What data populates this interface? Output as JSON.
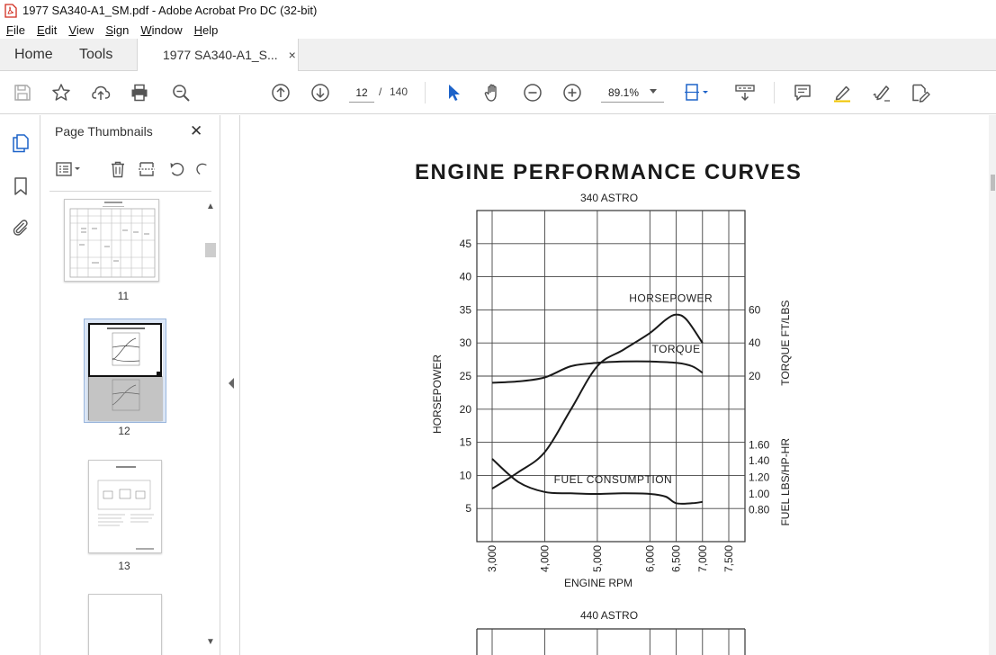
{
  "window": {
    "title": "1977 SA340-A1_SM.pdf - Adobe Acrobat Pro DC (32-bit)"
  },
  "menu": [
    {
      "label": "File",
      "key": "F",
      "rest": "ile"
    },
    {
      "label": "Edit",
      "key": "E",
      "rest": "dit"
    },
    {
      "label": "View",
      "key": "V",
      "rest": "iew"
    },
    {
      "label": "Sign",
      "key": "S",
      "rest": "ign"
    },
    {
      "label": "Window",
      "key": "W",
      "rest": "indow"
    },
    {
      "label": "Help",
      "key": "H",
      "rest": "elp"
    }
  ],
  "tabs": {
    "home": "Home",
    "tools": "Tools",
    "doc": "1977 SA340-A1_S...",
    "close": "×"
  },
  "toolbar": {
    "page_current": "12",
    "page_sep": "/",
    "page_total": "140",
    "zoom": "89.1%"
  },
  "panel": {
    "title": "Page Thumbnails",
    "close": "✕",
    "thumbs": [
      {
        "label": "11"
      },
      {
        "label": "12"
      },
      {
        "label": "13"
      }
    ]
  },
  "page": {
    "title": "ENGINE PERFORMANCE CURVES",
    "chart_subtitle": "340 ASTRO",
    "next_subtitle": "440 ASTRO"
  },
  "chart_data": {
    "type": "line",
    "title": "340 ASTRO",
    "xlabel": "ENGINE RPM",
    "ylabel_left": "HORSEPOWER",
    "ylabel_right_top": "TORQUE FT/LBS",
    "ylabel_right_bottom": "FUEL LBS/HP-HR",
    "x_ticks": [
      "3,000",
      "4,000",
      "5,000",
      "6,000",
      "6,500",
      "7,000",
      "7,500"
    ],
    "y_left_ticks": [
      "45",
      "40",
      "35",
      "30",
      "25",
      "20",
      "15",
      "10",
      "5"
    ],
    "y_right_top_ticks": [
      "60",
      "40",
      "20"
    ],
    "y_right_bottom_ticks": [
      "1.60",
      "1.40",
      "1.20",
      "1.00",
      "0.80"
    ],
    "xlim": [
      3000,
      7500
    ],
    "ylim": [
      0,
      50
    ],
    "grid": true,
    "series": [
      {
        "name": "HORSEPOWER",
        "x": [
          3000,
          3500,
          4000,
          4500,
          5000,
          5500,
          6000,
          6300,
          6500,
          6700,
          7000
        ],
        "y": [
          8,
          10.5,
          13.5,
          20,
          26.5,
          29,
          31.5,
          33.5,
          34.3,
          33.5,
          30
        ]
      },
      {
        "name": "TORQUE",
        "x": [
          3000,
          3500,
          4000,
          4500,
          5000,
          5500,
          6000,
          6500,
          6800,
          7000
        ],
        "y": [
          24,
          24.2,
          24.8,
          26.5,
          27,
          27.2,
          27.2,
          27,
          26.5,
          25.5
        ]
      },
      {
        "name": "FUEL CONSUMPTION",
        "x": [
          3000,
          3500,
          4000,
          4500,
          5000,
          5500,
          6000,
          6300,
          6500,
          6800,
          7000
        ],
        "y": [
          12.5,
          9,
          7.5,
          7.3,
          7.2,
          7.3,
          7.2,
          6.8,
          5.8,
          5.8,
          6
        ]
      }
    ]
  }
}
